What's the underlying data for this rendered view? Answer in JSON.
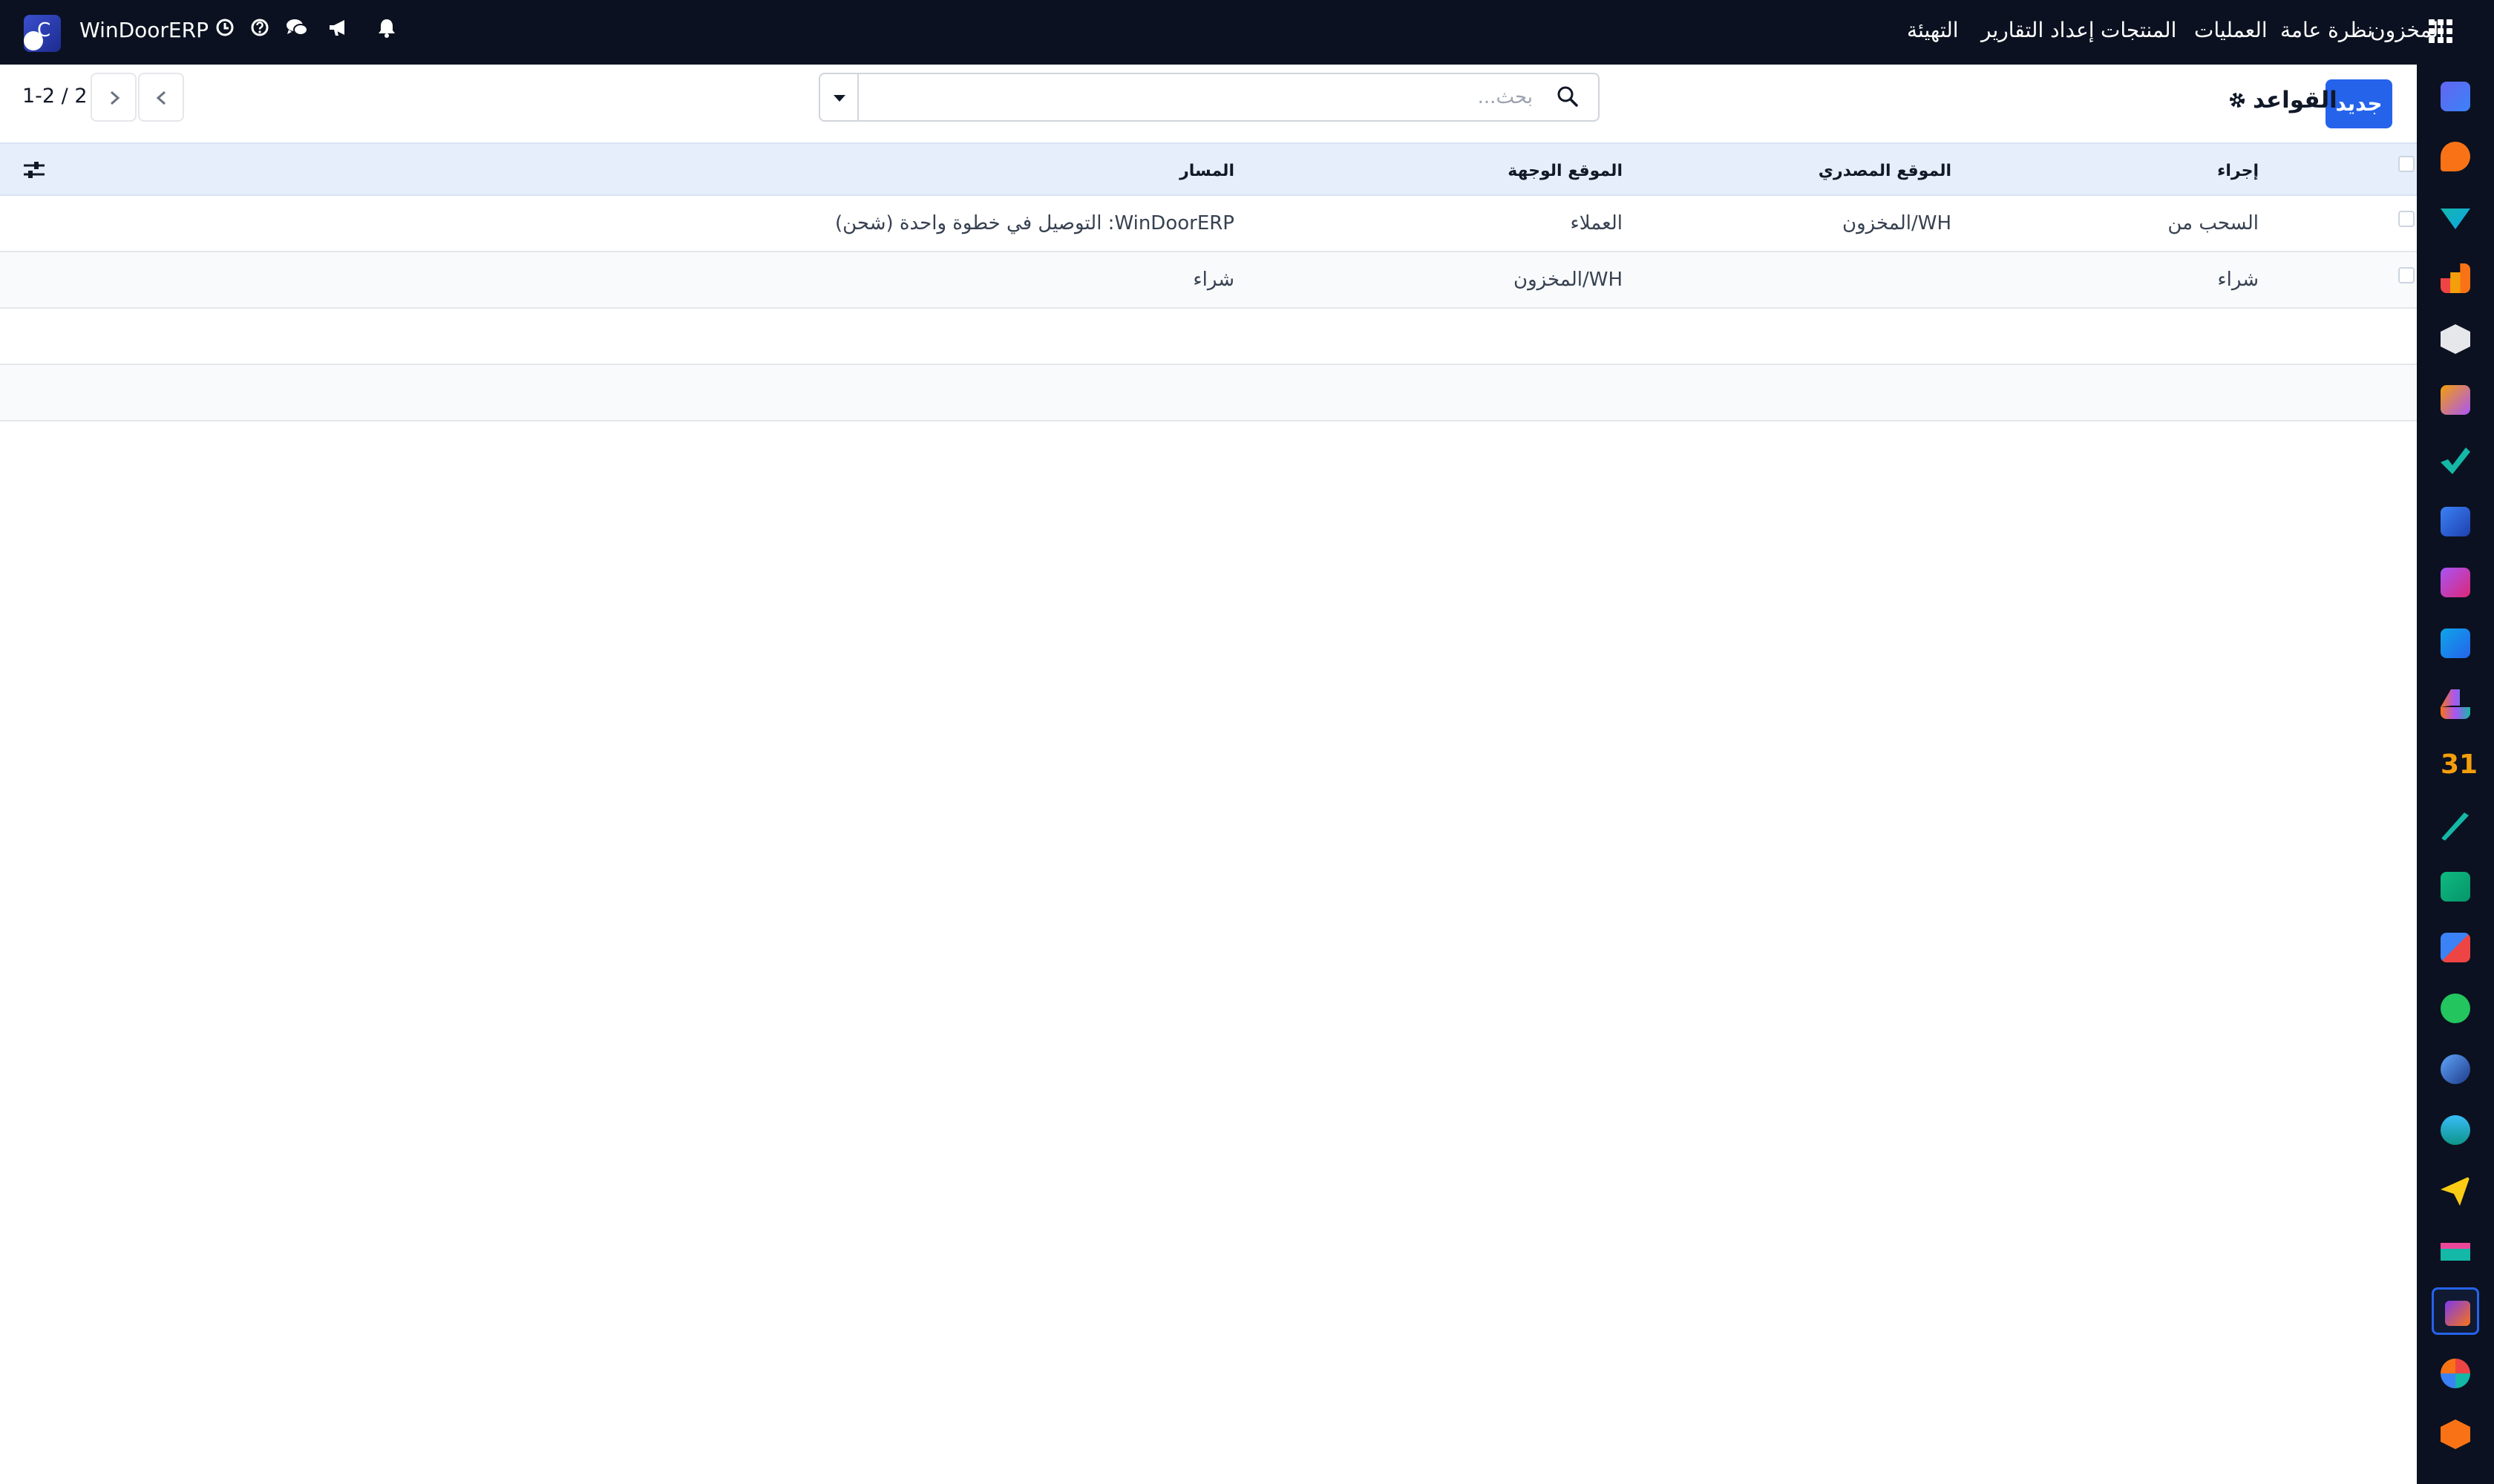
{
  "navbar": {
    "company": "WinDoorERP",
    "logo_letter": "C",
    "menu": {
      "app_name": "المخزون",
      "overview": "نظرة عامة",
      "operations": "العمليات",
      "products": "المنتجات",
      "reporting": "إعداد التقارير",
      "configuration": "التهيئة"
    }
  },
  "control_panel": {
    "new_label": "جديد",
    "title": "القواعد",
    "search_placeholder": "بحث...",
    "pager": "1-2 / 2"
  },
  "table": {
    "columns": {
      "action": "إجراء",
      "source": "الموقع المصدري",
      "destination": "الموقع الوجهة",
      "route": "المسار"
    },
    "rows": [
      {
        "action": "السحب من",
        "source": "WH/المخزون",
        "destination": "العملاء",
        "route": "WinDoorERP: التوصيل في خطوة واحدة (شحن)"
      },
      {
        "action": "شراء",
        "source": "",
        "destination": "WH/المخزون",
        "route": "شراء"
      }
    ]
  },
  "colors": {
    "navbar_bg": "#0b1120",
    "primary": "#2563eb",
    "header_bg": "#e6eefb"
  }
}
